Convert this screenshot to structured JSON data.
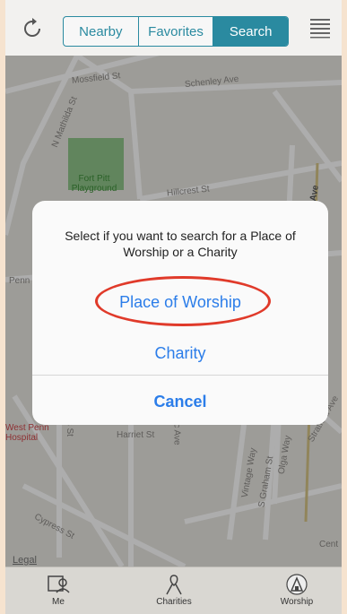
{
  "segments": [
    "Nearby",
    "Favorites",
    "Search"
  ],
  "active_segment": "Search",
  "map": {
    "labels": {
      "mossfield": "Mossfield St",
      "schenley": "Schenley Ave",
      "nmathilda": "N Mathilda St",
      "fortpitt": "Fort Pitt Playground",
      "hillcrest": "Hillcrest St",
      "ave": "Ave",
      "penn": "Penn",
      "westpenn": "West Penn Hospital",
      "stratford": "Stratford Ave",
      "vintage": "Vintage Way",
      "sgraham": "S Graham St",
      "olga": "Olga Way",
      "harriet": "Harriet St",
      "spacific": "S Pacific Ave",
      "cypress": "Cypress St",
      "gross": "Gross St",
      "legal": "Legal",
      "cent": "Cent"
    }
  },
  "dialog": {
    "message": "Select if you want to search for a Place of Worship or a Charity",
    "option_worship": "Place of Worship",
    "option_charity": "Charity",
    "cancel": "Cancel"
  },
  "tabs": [
    {
      "label": "Me"
    },
    {
      "label": "Charities"
    },
    {
      "label": "Worship"
    }
  ],
  "colors": {
    "accent": "#2a8aa0",
    "link": "#2b7de9",
    "highlight_circle": "#e03a2a"
  }
}
